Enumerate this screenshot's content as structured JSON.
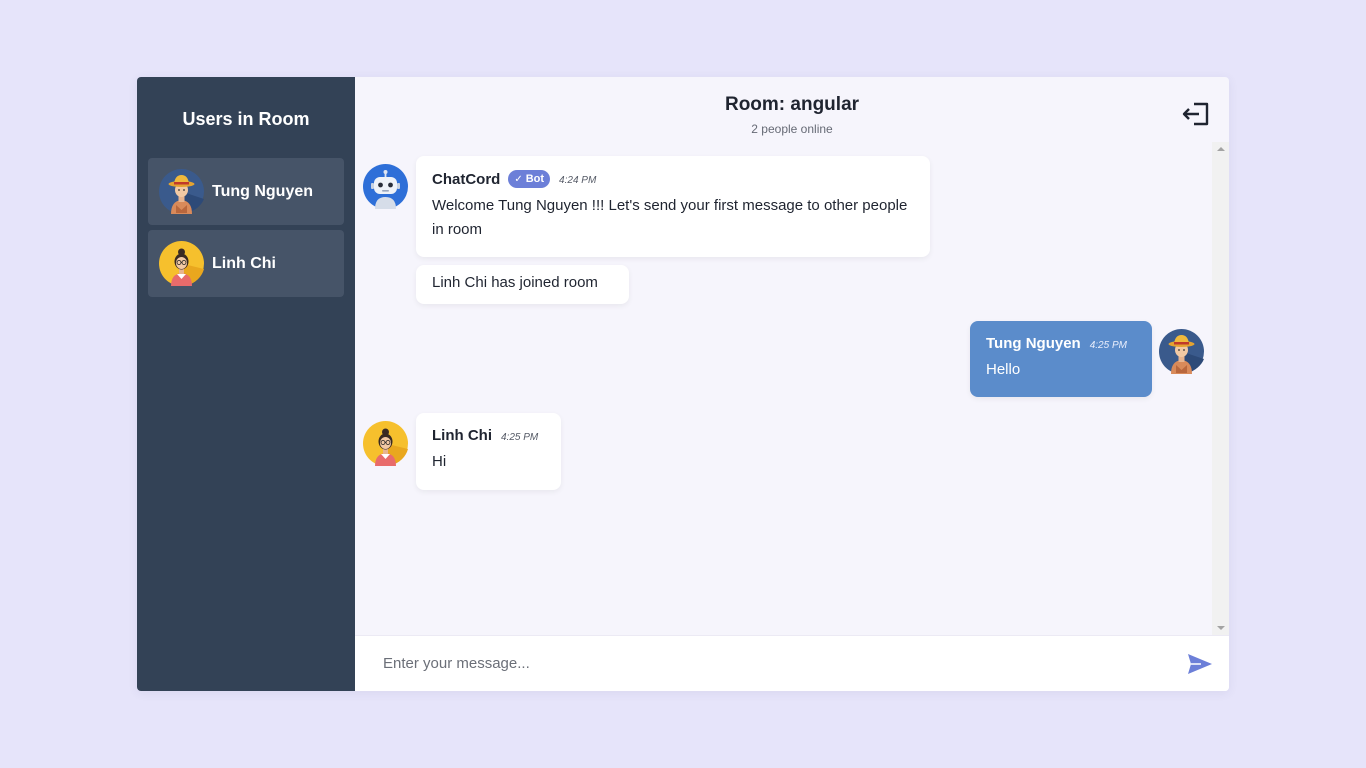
{
  "sidebar": {
    "title": "Users in Room",
    "users": [
      {
        "name": "Tung Nguyen",
        "avatar": "man-hat-avatar"
      },
      {
        "name": "Linh Chi",
        "avatar": "woman-glasses-avatar"
      }
    ]
  },
  "header": {
    "title": "Room: angular",
    "subtitle": "2 people online",
    "leave_icon": "exit-door-icon"
  },
  "messages": [
    {
      "sender": "ChatCord",
      "badge": "Bot",
      "time": "4:24 PM",
      "text": "Welcome Tung Nguyen !!! Let's send your first message to other people in room",
      "avatar": "robot-avatar"
    },
    {
      "notice": "Linh Chi has joined room"
    },
    {
      "sender": "Tung Nguyen",
      "time": "4:25 PM",
      "text": "Hello",
      "avatar": "man-hat-avatar",
      "mine": true
    },
    {
      "sender": "Linh Chi",
      "time": "4:25 PM",
      "text": "Hi",
      "avatar": "woman-glasses-avatar"
    }
  ],
  "composer": {
    "placeholder": "Enter your message...",
    "value": "",
    "send_icon": "send-arrow-icon"
  },
  "colors": {
    "page_bg": "#e6e4fa",
    "sidebar_bg": "#334256",
    "sidebar_item_bg": "#465468",
    "chat_bg": "#f6f5fc",
    "my_bubble": "#5b8ccb",
    "bot_badge": "#6c7fd8",
    "send_icon": "#6c7fd8"
  }
}
